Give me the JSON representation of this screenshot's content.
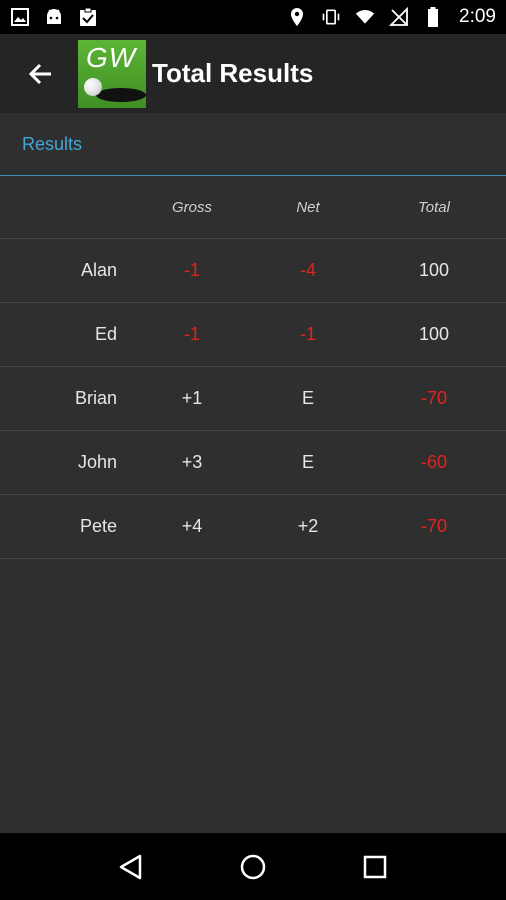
{
  "status_bar": {
    "time": "2:09",
    "left_icons": [
      "image-icon",
      "android-icon",
      "clipboard-check-icon"
    ],
    "right_icons": [
      "location-icon",
      "vibrate-icon",
      "wifi-icon",
      "no-signal-icon",
      "battery-icon"
    ]
  },
  "toolbar": {
    "back_icon": "arrow-left-icon",
    "logo_text": "GW",
    "title": "Total Results"
  },
  "section": {
    "label": "Results"
  },
  "table": {
    "columns": [
      "Gross",
      "Net",
      "Total"
    ],
    "rows": [
      {
        "name": "Alan",
        "gross": "-1",
        "net": "-4",
        "total": "100"
      },
      {
        "name": "Ed",
        "gross": "-1",
        "net": "-1",
        "total": "100"
      },
      {
        "name": "Brian",
        "gross": "+1",
        "net": "E",
        "total": "-70"
      },
      {
        "name": "John",
        "gross": "+3",
        "net": "E",
        "total": "-60"
      },
      {
        "name": "Pete",
        "gross": "+4",
        "net": "+2",
        "total": "-70"
      }
    ]
  },
  "nav_bar": {
    "icons": [
      "back-triangle-icon",
      "home-circle-icon",
      "recents-square-icon"
    ]
  },
  "colors": {
    "negative": "#e0241f",
    "accent": "#43a5d6"
  }
}
